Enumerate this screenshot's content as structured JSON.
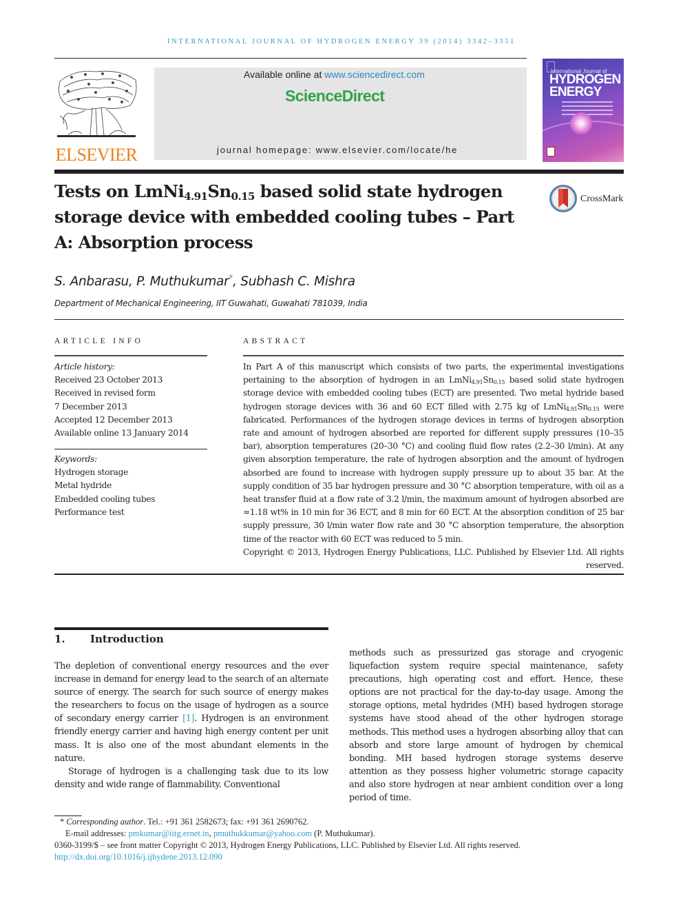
{
  "header": {
    "running_head": "International Journal of Hydrogen Energy 39 (2014) 3342–3351",
    "publisher_logo": "ELSEVIER",
    "available_online_prefix": "Available online at ",
    "available_online_link": "www.sciencedirect.com",
    "sciencedirect_logo": "ScienceDirect",
    "journal_homepage": "journal homepage: www.elsevier.com/locate/he",
    "cover": {
      "small_title": "International Journal of",
      "big_title_line1": "HYDROGEN",
      "big_title_line2": "ENERGY"
    }
  },
  "colors": {
    "link": "#2e9cc7",
    "elsevier_orange": "#f07f1b",
    "sciencedirect_green": "#31a24a",
    "running_head": "#3a9ab8"
  },
  "article": {
    "title_part1": "Tests on LmNi",
    "title_sub1": "4.91",
    "title_part2": "Sn",
    "title_sub2": "0.15",
    "title_part3": " based solid state hydrogen storage device with embedded cooling tubes – Part A: Absorption process",
    "crossmark_label": "CrossMark",
    "authors": {
      "author1": "S. Anbarasu, ",
      "author2": "P. Muthukumar",
      "author2_mark": "*",
      "author3": ", Subhash C. Mishra"
    },
    "affiliation": "Department of Mechanical Engineering, IIT Guwahati, Guwahati 781039, India"
  },
  "article_info": {
    "heading": "ARTICLE INFO",
    "history_label": "Article history:",
    "history": [
      "Received 23 October 2013",
      "Received in revised form",
      "7 December 2013",
      "Accepted 12 December 2013",
      "Available online 13 January 2014"
    ],
    "keywords_label": "Keywords:",
    "keywords": [
      "Hydrogen storage",
      "Metal hydride",
      "Embedded cooling tubes",
      "Performance test"
    ]
  },
  "abstract": {
    "heading": "ABSTRACT",
    "seg1": "In Part A of this manuscript which consists of two parts, the experimental investigations pertaining to the absorption of hydrogen in an LmNi",
    "sub1": "4.91",
    "seg2": "Sn",
    "sub2": "0.15",
    "seg3": " based solid state hydrogen storage device with embedded cooling tubes (ECT) are presented. Two metal hydride based hydrogen storage devices with 36 and 60 ECT filled with 2.75 kg of LmNi",
    "sub3": "4.91",
    "seg4": "Sn",
    "sub4": "0.15",
    "seg5": " were fabricated. Performances of the hydrogen storage devices in terms of hydrogen absorption rate and amount of hydrogen absorbed are reported for different supply pressures (10–35 bar), absorption temperatures (20–30 °C) and cooling fluid flow rates (2.2–30 l/min). At any given absorption temperature, the rate of hydrogen absorption and the amount of hydrogen absorbed are found to increase with hydrogen supply pressure up to about 35 bar. At the supply condition of 35 bar hydrogen pressure and 30 °C absorption temperature, with oil as a heat transfer fluid at a flow rate of 3.2 l/min, the maximum amount of hydrogen absorbed are ≈1.18 wt% in 10 min for 36 ECT, and 8 min for 60 ECT. At the absorption condition of 25 bar supply pressure, 30 l/min water flow rate and 30 °C absorption temperature, the absorption time of the reactor with 60 ECT was reduced to 5 min.",
    "copyright": "Copyright © 2013, Hydrogen Energy Publications, LLC. Published by Elsevier Ltd. All rights reserved."
  },
  "introduction": {
    "number": "1.",
    "title": "Introduction",
    "p1_a": "The depletion of conventional energy resources and the ever increase in demand for energy lead to the search of an alternate source of energy. The search for such source of energy makes the researchers to focus on the usage of hydrogen as a source of secondary energy carrier ",
    "p1_ref": "[1]",
    "p1_b": ". Hydrogen is an environment friendly energy carrier and having high energy content per unit mass. It is also one of the most abundant elements in the nature.",
    "p2_left": "Storage of hydrogen is a challenging task due to its low density and wide range of flammability. Conventional",
    "p2_right": "methods such as pressurized gas storage and cryogenic liquefaction system require special maintenance, safety precautions, high operating cost and effort. Hence, these options are not practical for the day-to-day usage. Among the storage options, metal hydrides (MH) based hydrogen storage systems have stood ahead of the other hydrogen storage methods. This method uses a hydrogen absorbing alloy that can absorb and store large amount of hydrogen by chemical bonding. MH based hydrogen storage systems deserve attention as they possess higher volumetric storage capacity and also store hydrogen at near ambient condition over a long period of time."
  },
  "footnotes": {
    "corr_mark": "* ",
    "corr_label": "Corresponding author",
    "corr_text": ". Tel.: +91 361 2582673; fax: +91 361 2690762.",
    "email_label": "E-mail addresses: ",
    "email1": "pmkumar@iitg.ernet.in",
    "email_sep": ", ",
    "email2": "pmuthukkumar@yahoo.com",
    "email_owner": " (P. Muthukumar).",
    "issn_line": "0360-3199/$ – see front matter Copyright © 2013, Hydrogen Energy Publications, LLC. Published by Elsevier Ltd. All rights reserved.",
    "doi": "http://dx.doi.org/10.1016/j.ijhydene.2013.12.090"
  }
}
